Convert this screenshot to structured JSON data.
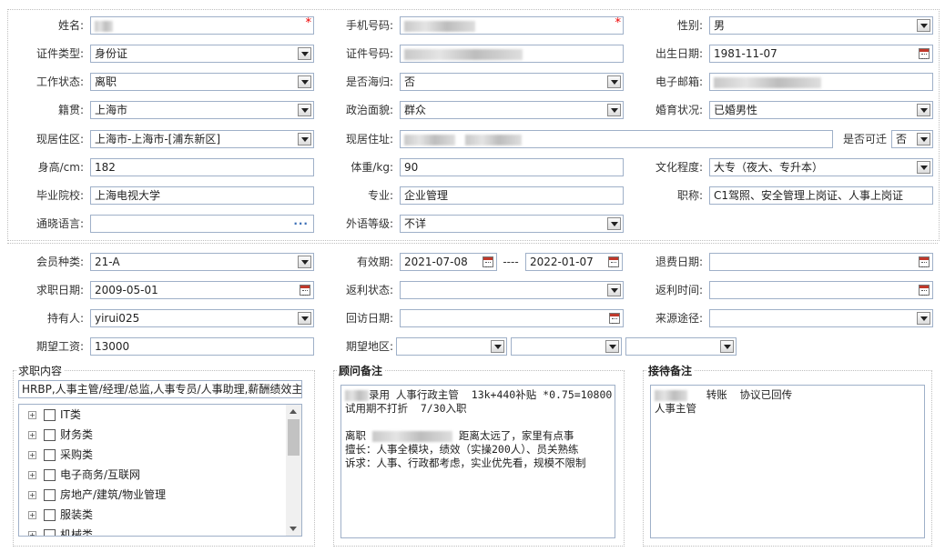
{
  "personal": {
    "name_label": "姓名:",
    "phone_label": "手机号码:",
    "gender_label": "性别:",
    "gender": "男",
    "id_type_label": "证件类型:",
    "id_type": "身份证",
    "id_no_label": "证件号码:",
    "birth_label": "出生日期:",
    "birth": "1981-11-07",
    "work_status_label": "工作状态:",
    "work_status": "离职",
    "overseas_label": "是否海归:",
    "overseas": "否",
    "email_label": "电子邮箱:",
    "native_label": "籍贯:",
    "native": "上海市",
    "politics_label": "政治面貌:",
    "politics": "群众",
    "marital_label": "婚育状况:",
    "marital": "已婚男性",
    "residence_area_label": "现居住区:",
    "residence_area": "上海市-上海市-[浦东新区]",
    "address_label": "现居住址:",
    "relocate_label": "是否可迁",
    "relocate": "否",
    "height_label": "身高/cm:",
    "height": "182",
    "weight_label": "体重/kg:",
    "weight": "90",
    "education_label": "文化程度:",
    "education": "大专（夜大、专升本）",
    "school_label": "毕业院校:",
    "school": "上海电视大学",
    "major_label": "专业:",
    "major": "企业管理",
    "title_label": "职称:",
    "title": "C1驾照、安全管理上岗证、人事上岗证",
    "language_label": "通晓语言:",
    "language": "",
    "foreign_level_label": "外语等级:",
    "foreign_level": "不详"
  },
  "member": {
    "type_label": "会员种类:",
    "type": "21-A",
    "validity_label": "有效期:",
    "valid_from": "2021-07-08",
    "valid_sep": "----",
    "valid_to": "2022-01-07",
    "refund_date_label": "退费日期:",
    "refund_date": "",
    "job_date_label": "求职日期:",
    "job_date": "2009-05-01",
    "rebate_status_label": "返利状态:",
    "rebate_status": "",
    "rebate_time_label": "返利时间:",
    "rebate_time": "",
    "holder_label": "持有人:",
    "holder": "yirui025",
    "revisit_label": "回访日期:",
    "revisit": "",
    "source_label": "来源途径:",
    "source": "",
    "salary_label": "期望工资:",
    "salary": "13000",
    "region_label": "期望地区:"
  },
  "job_content": {
    "legend": "求职内容",
    "summary": "HRBP,人事主管/经理/总监,人事专员/人事助理,薪酬绩效主",
    "tree": [
      "IT类",
      "财务类",
      "采购类",
      "电子商务/互联网",
      "房地产/建筑/物业管理",
      "服装类",
      "机械类"
    ]
  },
  "consultant_notes": {
    "legend": "顾问备注",
    "line1": "录用 人事行政主管  13k+440补贴 *0.75=10800",
    "line2": "试用期不打折  7/30入职",
    "line3": "离职",
    "line3b": " 距离太远了，家里有点事",
    "line4": "擅长：人事全模块，绩效（实操200人）、员关熟练",
    "line5": "诉求：人事、行政都考虑，实业优先看，规模不限制"
  },
  "reception_notes": {
    "legend": "接待备注",
    "line1": "   转账  协议已回传",
    "line2": "人事主管"
  },
  "colors": {
    "required": "#e00000",
    "border": "#9fb0c8",
    "link_dots": "#3b6fb6"
  }
}
